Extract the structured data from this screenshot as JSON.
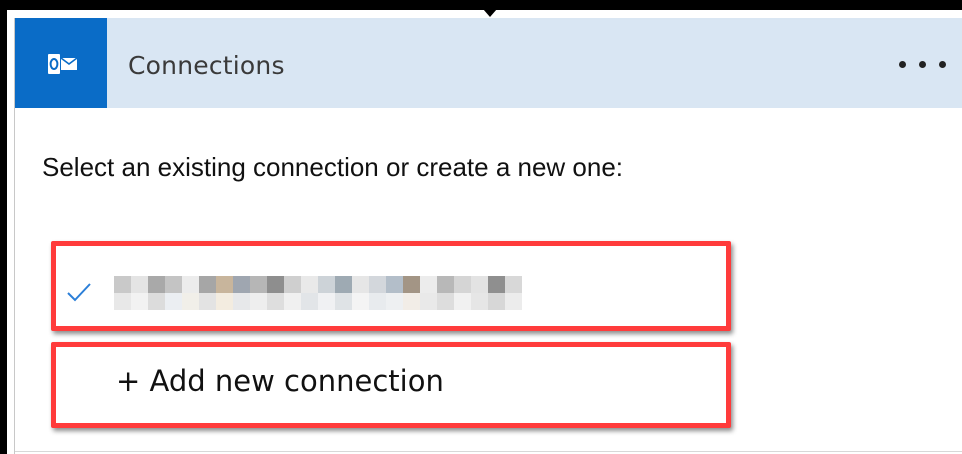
{
  "header": {
    "title": "Connections",
    "app_icon": "outlook-icon",
    "more_icon": "more-horizontal-icon",
    "background_color": "#d9e6f3",
    "tile_color": "#0a6cc7"
  },
  "prompt": "Select an existing connection or create a new one:",
  "connections": [
    {
      "selected": true,
      "status_icon": "checkmark-icon",
      "name_obscured": true
    }
  ],
  "add_connection": {
    "label": "+ Add new connection"
  },
  "highlight_color": "#ff3b3b"
}
